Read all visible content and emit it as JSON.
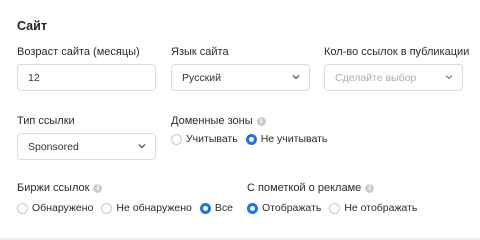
{
  "section": {
    "title": "Сайт"
  },
  "site_age": {
    "label": "Возраст сайта (месяцы)",
    "value": "12"
  },
  "site_language": {
    "label": "Язык сайта",
    "value": "Русский"
  },
  "links_count": {
    "label": "Кол-во ссылок в публикации",
    "placeholder": "Сделайте выбор"
  },
  "link_type": {
    "label": "Тип ссылки",
    "value": "Sponsored"
  },
  "domain_zones": {
    "label": "Доменные зоны",
    "options": [
      "Учитывать",
      "Не учитывать"
    ],
    "selected": "Не учитывать"
  },
  "exchanges": {
    "label": "Биржи ссылок",
    "options": [
      "Обнаружено",
      "Не обнаружено",
      "Все"
    ],
    "selected": "Все"
  },
  "ad_mark": {
    "label": "С пометкой о рекламе",
    "options": [
      "Отображать",
      "Не отображать"
    ],
    "selected": "Отображать"
  },
  "colors": {
    "accent": "#1a73e8",
    "border": "#d9dce1",
    "info_icon": "#c9ccd1"
  },
  "icons": {
    "info": "info-icon",
    "dropdown": "chevron-down-icon"
  }
}
